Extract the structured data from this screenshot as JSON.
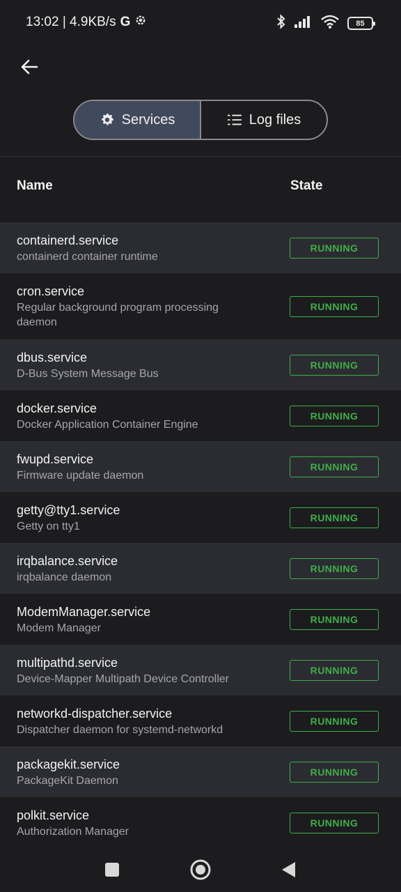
{
  "status_bar": {
    "time_speed": "13:02 | 4.9KB/s",
    "network_letter": "G",
    "battery": "85"
  },
  "tabs": [
    {
      "label": "Services",
      "active": true,
      "icon": "gear-icon"
    },
    {
      "label": "Log files",
      "active": false,
      "icon": "list-icon"
    }
  ],
  "table": {
    "col_name": "Name",
    "col_state": "State"
  },
  "services": [
    {
      "name": "containerd.service",
      "description": "containerd container runtime",
      "state": "RUNNING"
    },
    {
      "name": "cron.service",
      "description": "Regular background program processing daemon",
      "state": "RUNNING"
    },
    {
      "name": "dbus.service",
      "description": "D-Bus System Message Bus",
      "state": "RUNNING"
    },
    {
      "name": "docker.service",
      "description": "Docker Application Container Engine",
      "state": "RUNNING"
    },
    {
      "name": "fwupd.service",
      "description": "Firmware update daemon",
      "state": "RUNNING"
    },
    {
      "name": "getty@tty1.service",
      "description": "Getty on tty1",
      "state": "RUNNING"
    },
    {
      "name": "irqbalance.service",
      "description": "irqbalance daemon",
      "state": "RUNNING"
    },
    {
      "name": "ModemManager.service",
      "description": "Modem Manager",
      "state": "RUNNING"
    },
    {
      "name": "multipathd.service",
      "description": "Device-Mapper Multipath Device Controller",
      "state": "RUNNING"
    },
    {
      "name": "networkd-dispatcher.service",
      "description": "Dispatcher daemon for systemd-networkd",
      "state": "RUNNING"
    },
    {
      "name": "packagekit.service",
      "description": "PackageKit Daemon",
      "state": "RUNNING"
    },
    {
      "name": "polkit.service",
      "description": "Authorization Manager",
      "state": "RUNNING"
    }
  ],
  "colors": {
    "running": "#3fae4a",
    "active_tab": "#414a5c",
    "background": "#1c1c1e",
    "row_alt": "#2b2c31"
  }
}
